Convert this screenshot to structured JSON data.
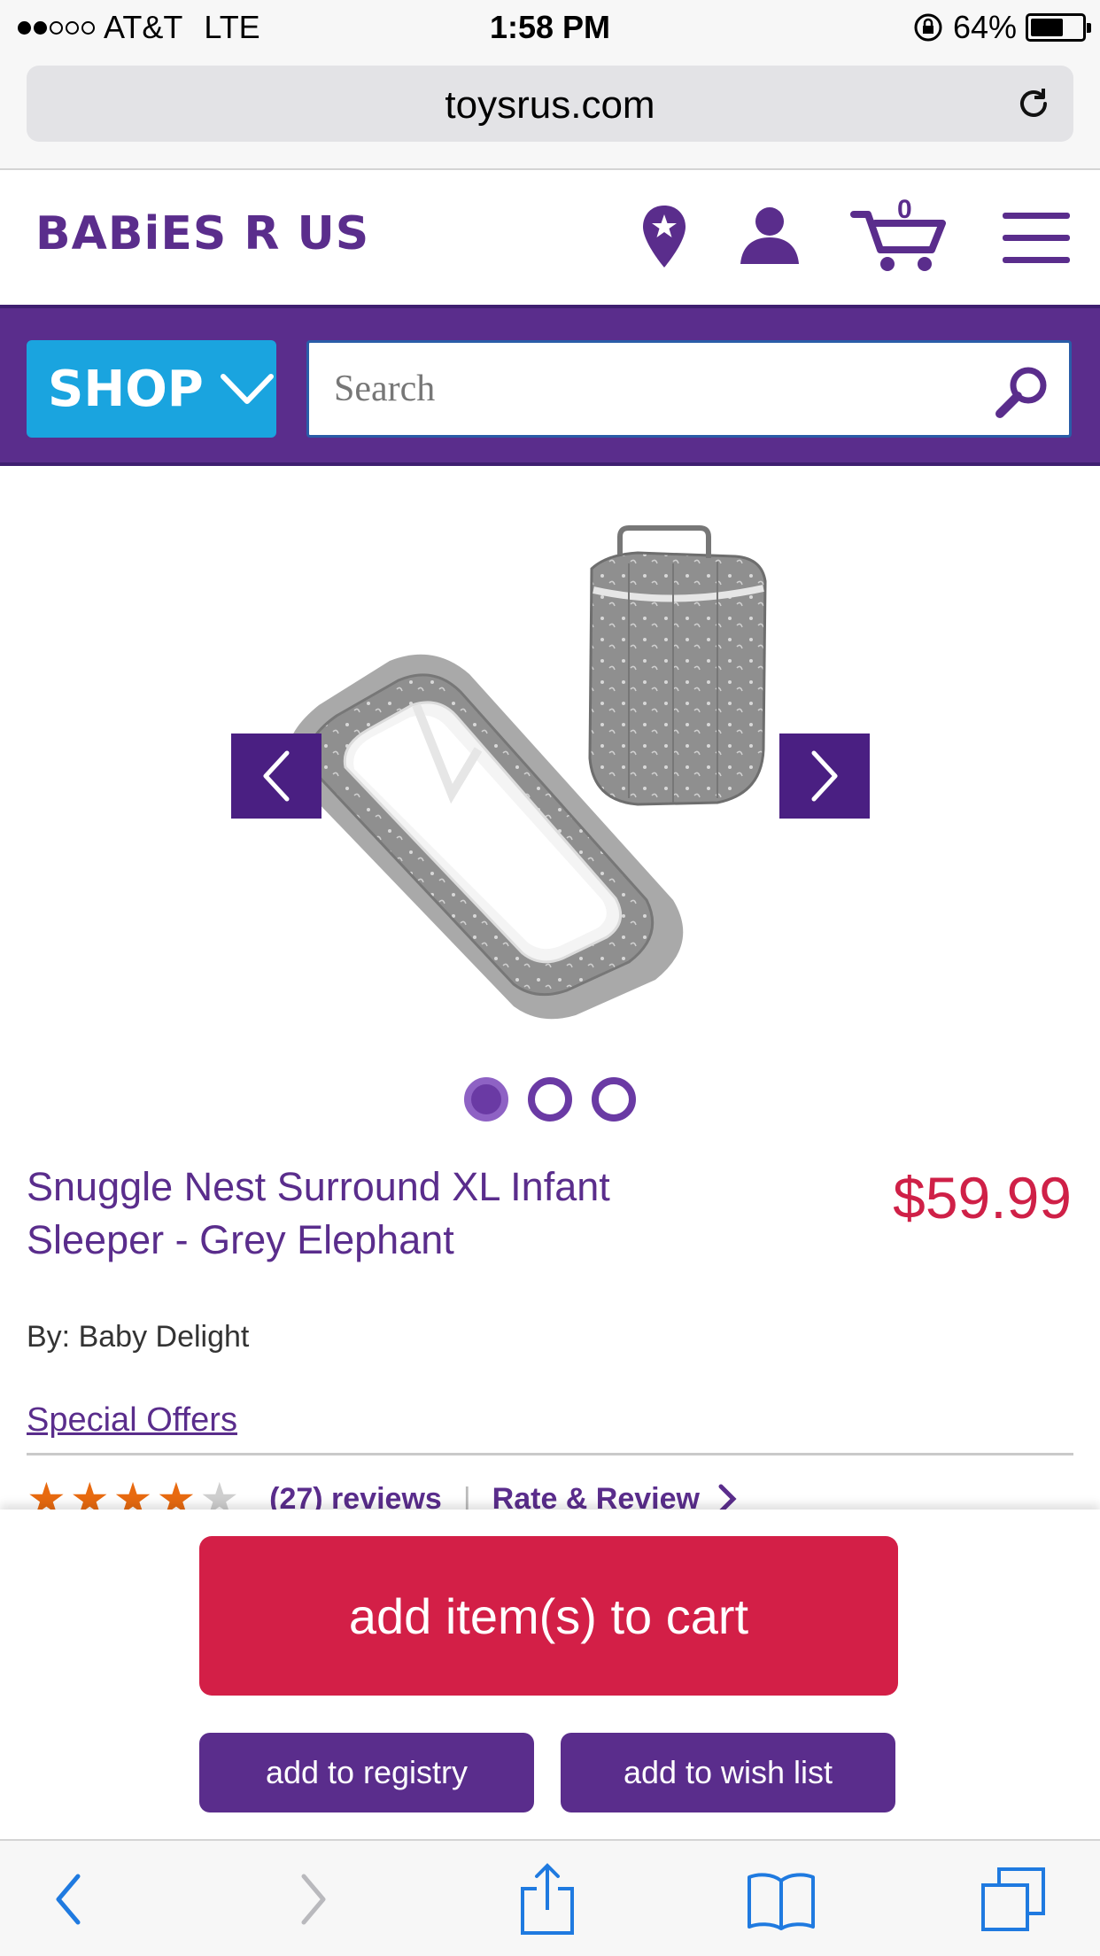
{
  "status_bar": {
    "carrier": "AT&T",
    "network": "LTE",
    "time": "1:58 PM",
    "battery": "64%",
    "battery_level": 0.64,
    "signal_bars_filled": 2,
    "signal_bars_total": 5
  },
  "browser": {
    "url": "toysrus.com"
  },
  "header": {
    "logo_text": "BABiES R US",
    "cart_count": "0"
  },
  "nav": {
    "shop_label": "SHOP",
    "search_placeholder": "Search"
  },
  "gallery": {
    "image_count": 3,
    "active_index": 0
  },
  "product": {
    "title": "Snuggle Nest Surround XL Infant Sleeper - Grey Elephant",
    "price": "$59.99",
    "brand": "By: Baby Delight",
    "special_offers": "Special Offers",
    "rating": 4,
    "rating_max": 5,
    "reviews_count": "(27) reviews",
    "rate_review": "Rate & Review"
  },
  "actions": {
    "add_to_cart": "add item(s) to cart",
    "add_to_registry": "add to registry",
    "add_to_wish_list": "add to wish list"
  },
  "colors": {
    "brand_purple": "#5a2d8c",
    "shop_blue": "#1aa4df",
    "price_red": "#cf2047",
    "cart_red": "#d31f47",
    "star_orange": "#e86a10",
    "ios_blue": "#1f7ae0"
  },
  "icons": {
    "store_locator": "map-pin-star-icon",
    "account": "user-icon",
    "cart": "shopping-cart-icon",
    "menu": "hamburger-menu-icon",
    "search": "magnifier-icon"
  }
}
